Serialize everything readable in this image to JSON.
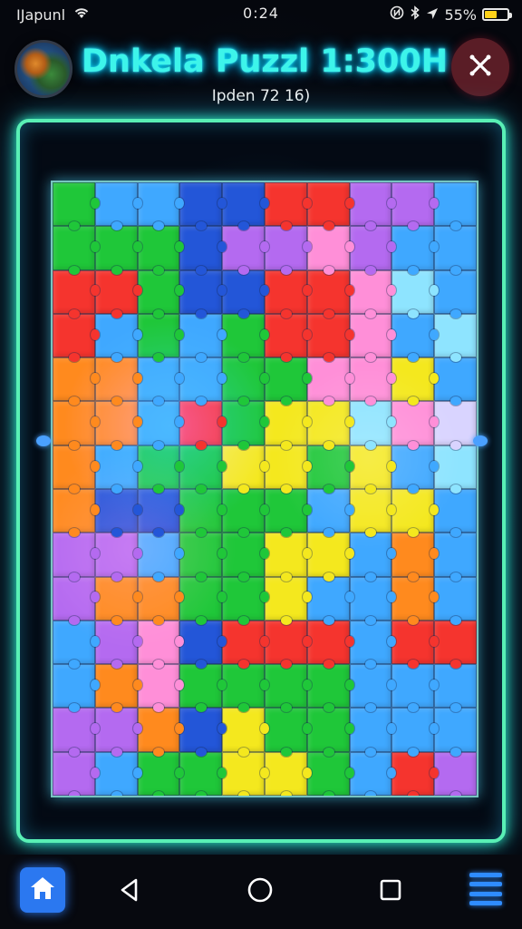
{
  "status_bar": {
    "carrier": "IJapunl",
    "time": "0:24",
    "battery_percent": "55%",
    "battery_level": 0.55,
    "icons": [
      "wifi-icon",
      "nfc-icon",
      "bluetooth-icon",
      "location-icon",
      "battery-icon"
    ]
  },
  "header": {
    "title": "Dnkela Puzzl 1:300H",
    "subtitle": "Ipden 72 16)",
    "avatar_icon": "earth-globe-avatar",
    "close_icon": "close-icon"
  },
  "puzzle": {
    "columns": 10,
    "rows": 14,
    "palette": {
      "R": "#f5342e",
      "O": "#ff8a1e",
      "Y": "#f4e81e",
      "G": "#1fc739",
      "L": "#3fa8ff",
      "B": "#2356d8",
      "P": "#b46af0",
      "K": "#ff8fd8",
      "C": "#8ee4ff",
      "W": "#d9d4ff"
    },
    "grid": [
      "GLLBBRRPPL",
      "GGGBPPKPLL",
      "RRGBBRRKCL",
      "RLGLGRRKLC",
      "OOLLGGKKYL",
      "OOLRGYYCKW",
      "OLGGYYGYLC",
      "OBBGGGLYYL",
      "PPLGGYYLOL",
      "POOGGYLLOL",
      "LPKBRRRLRR",
      "LOKGGGGLLL",
      "PPOBYGGLLL",
      "PLGGYYGLRP"
    ]
  },
  "nav": {
    "home_icon": "home-icon",
    "back_icon": "back-triangle-icon",
    "home_circle_icon": "home-circle-icon",
    "recents_icon": "recents-square-icon",
    "menu_icon": "menu-icon"
  }
}
